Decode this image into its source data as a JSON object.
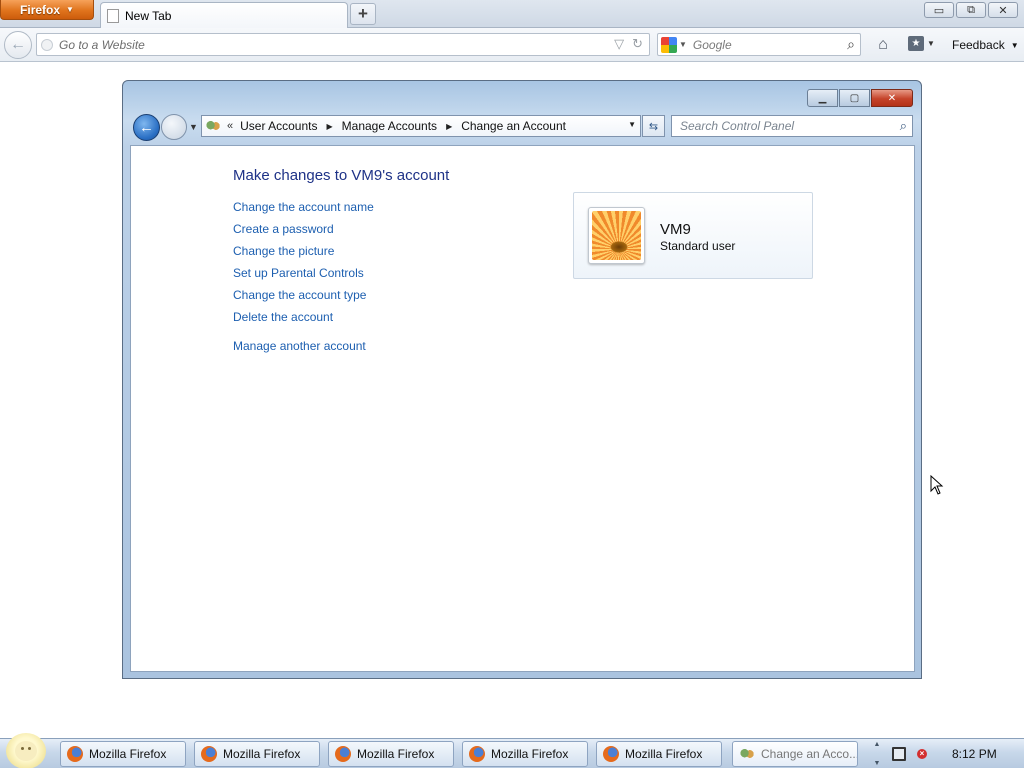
{
  "browser": {
    "menu_button": "Firefox",
    "tab_title": "New Tab",
    "new_tab_symbol": "+",
    "url_placeholder": "Go to a Website",
    "search_placeholder": "Google",
    "feedback_label": "Feedback",
    "window_controls": {
      "minimize": "▭",
      "restore": "⧉",
      "close": "✕"
    }
  },
  "control_panel": {
    "breadcrumbs": [
      "User Accounts",
      "Manage Accounts",
      "Change an Account"
    ],
    "breadcrumb_prefix": "«",
    "search_placeholder": "Search Control Panel",
    "heading": "Make changes to VM9's account",
    "tasks": [
      "Change the account name",
      "Create a password",
      "Change the picture",
      "Set up Parental Controls",
      "Change the account type",
      "Delete the account"
    ],
    "manage_another": "Manage another account",
    "account": {
      "name": "VM9",
      "type": "Standard user"
    }
  },
  "taskbar": {
    "items": [
      {
        "label": "Mozilla Firefox",
        "icon": "firefox-icon"
      },
      {
        "label": "Mozilla Firefox",
        "icon": "firefox-icon"
      },
      {
        "label": "Mozilla Firefox",
        "icon": "firefox-icon"
      },
      {
        "label": "Mozilla Firefox",
        "icon": "firefox-icon"
      },
      {
        "label": "Mozilla Firefox",
        "icon": "firefox-icon"
      },
      {
        "label": "Change an Acco...",
        "icon": "control-panel-icon",
        "active": true
      }
    ],
    "clock": "8:12 PM"
  },
  "colors": {
    "link": "#1d5fb0",
    "heading": "#1e3287",
    "firefox_orange": "#e0741d",
    "close_red": "#c5432a"
  }
}
